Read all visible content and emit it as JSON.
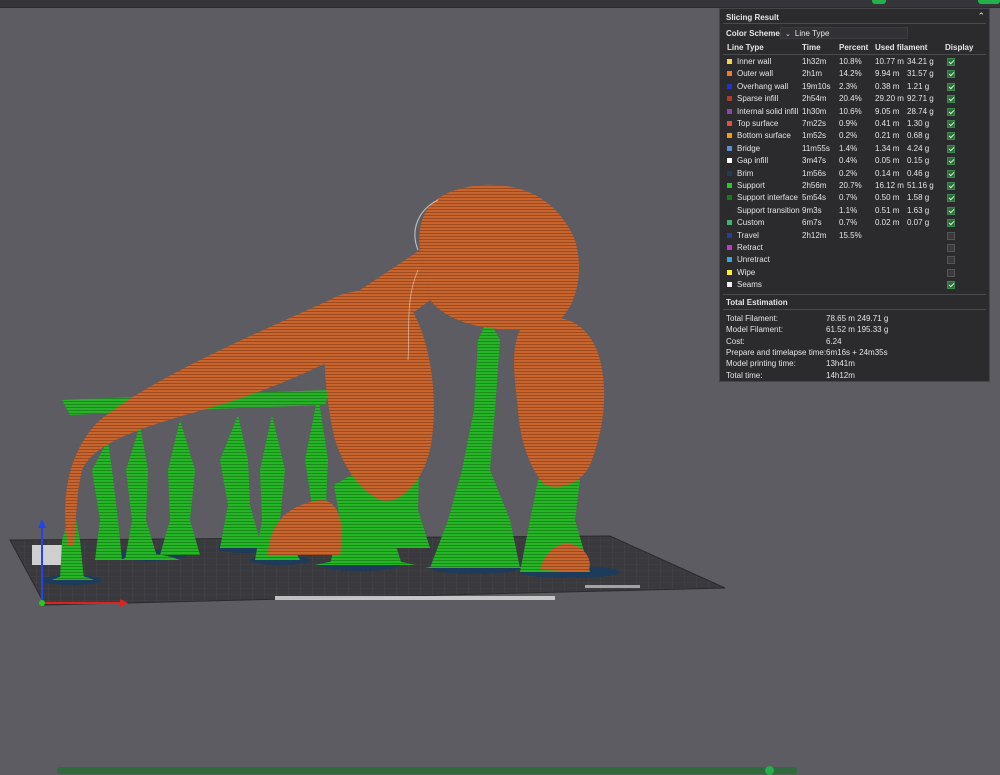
{
  "panel": {
    "title": "Slicing Result",
    "color_scheme_label": "Color Scheme",
    "color_scheme_value": "Line Type",
    "columns": [
      "Line Type",
      "Time",
      "Percent",
      "Used filament",
      "Display"
    ],
    "rows": [
      {
        "name": "Inner wall",
        "color": "#f3d350",
        "time": "1h32m",
        "percent": "10.8%",
        "length": "10.77 m",
        "weight": "34.21 g",
        "display": true
      },
      {
        "name": "Outer wall",
        "color": "#f0782a",
        "time": "2h1m",
        "percent": "14.2%",
        "length": "9.94 m",
        "weight": "31.57 g",
        "display": true
      },
      {
        "name": "Overhang wall",
        "color": "#2233cc",
        "time": "19m10s",
        "percent": "2.3%",
        "length": "0.38 m",
        "weight": "1.21 g",
        "display": true
      },
      {
        "name": "Sparse infill",
        "color": "#b03a2e",
        "time": "2h54m",
        "percent": "20.4%",
        "length": "29.20 m",
        "weight": "92.71 g",
        "display": true
      },
      {
        "name": "Internal solid infill",
        "color": "#8e44ad",
        "time": "1h30m",
        "percent": "10.6%",
        "length": "9.05 m",
        "weight": "28.74 g",
        "display": true
      },
      {
        "name": "Top surface",
        "color": "#e74c3c",
        "time": "7m22s",
        "percent": "0.9%",
        "length": "0.41 m",
        "weight": "1.30 g",
        "display": true
      },
      {
        "name": "Bottom surface",
        "color": "#f39c12",
        "time": "1m52s",
        "percent": "0.2%",
        "length": "0.21 m",
        "weight": "0.68 g",
        "display": true
      },
      {
        "name": "Bridge",
        "color": "#5b8fd0",
        "time": "11m55s",
        "percent": "1.4%",
        "length": "1.34 m",
        "weight": "4.24 g",
        "display": true
      },
      {
        "name": "Gap infill",
        "color": "#ffffff",
        "time": "3m47s",
        "percent": "0.4%",
        "length": "0.05 m",
        "weight": "0.15 g",
        "display": true
      },
      {
        "name": "Brim",
        "color": "#1c3d5a",
        "time": "1m56s",
        "percent": "0.2%",
        "length": "0.14 m",
        "weight": "0.46 g",
        "display": true
      },
      {
        "name": "Support",
        "color": "#22cc22",
        "time": "2h56m",
        "percent": "20.7%",
        "length": "16.12 m",
        "weight": "51.16 g",
        "display": true
      },
      {
        "name": "Support interface",
        "color": "#1a7a1a",
        "time": "5m54s",
        "percent": "0.7%",
        "length": "0.50 m",
        "weight": "1.58 g",
        "display": true
      },
      {
        "name": "Support transition",
        "color": "#2a2a2a",
        "time": "9m3s",
        "percent": "1.1%",
        "length": "0.51 m",
        "weight": "1.63 g",
        "display": true
      },
      {
        "name": "Custom",
        "color": "#3cb371",
        "time": "6m7s",
        "percent": "0.7%",
        "length": "0.02 m",
        "weight": "0.07 g",
        "display": true
      },
      {
        "name": "Travel",
        "color": "#2a3aa0",
        "time": "2h12m",
        "percent": "15.5%",
        "length": "",
        "weight": "",
        "display": false
      },
      {
        "name": "Retract",
        "color": "#cc33cc",
        "time": "",
        "percent": "",
        "length": "",
        "weight": "",
        "display": false
      },
      {
        "name": "Unretract",
        "color": "#33aadd",
        "time": "",
        "percent": "",
        "length": "",
        "weight": "",
        "display": false
      },
      {
        "name": "Wipe",
        "color": "#ffee22",
        "time": "",
        "percent": "",
        "length": "",
        "weight": "",
        "display": false
      },
      {
        "name": "Seams",
        "color": "#f0f0f0",
        "time": "",
        "percent": "",
        "length": "",
        "weight": "",
        "display": true
      }
    ],
    "estimation": {
      "title": "Total Estimation",
      "items": [
        {
          "label": "Total Filament:",
          "value": "78.65 m    249.71 g"
        },
        {
          "label": "Model Filament:",
          "value": "61.52 m    195.33 g"
        },
        {
          "label": "Cost:",
          "value": "6.24"
        },
        {
          "label": "Prepare and timelapse time:",
          "value": "6m16s + 24m35s"
        },
        {
          "label": "Model printing time:",
          "value": "13h41m"
        },
        {
          "label": "Total time:",
          "value": "14h12m"
        }
      ]
    }
  },
  "colors": {
    "background": "#5c5c62",
    "model_orange": "#c8642e",
    "support_green": "#22b022",
    "accent": "#23b04a"
  }
}
